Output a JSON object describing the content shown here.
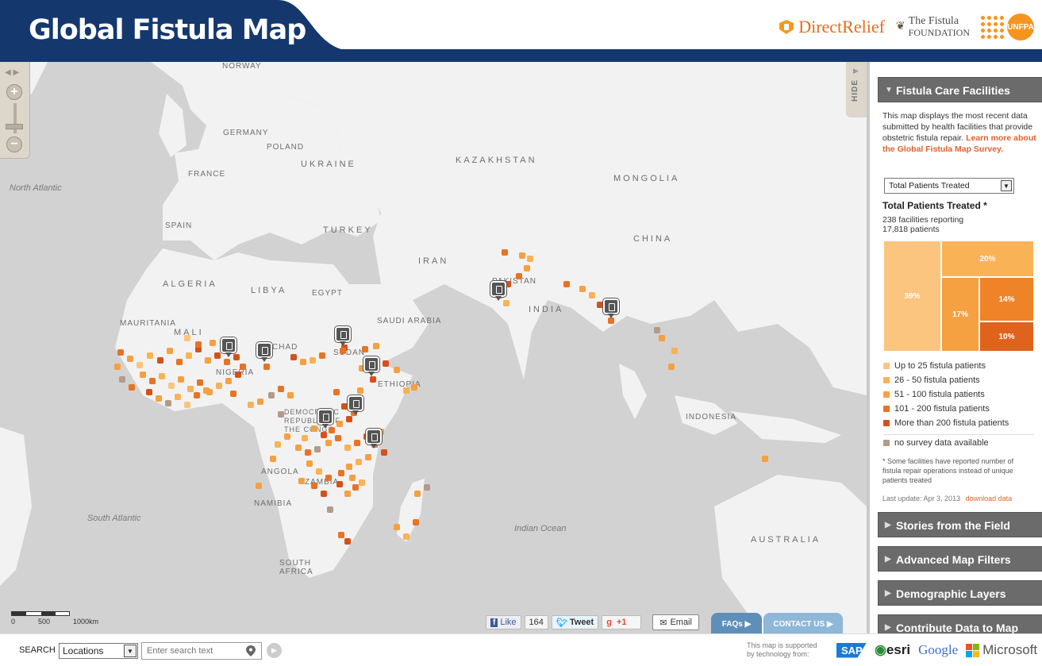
{
  "header": {
    "title": "Global Fistula Map",
    "logos": {
      "direct_relief": "DirectRelief",
      "fistula_line1": "The Fistula",
      "fistula_line2": "Foundation",
      "unfpa": "UNFPA"
    }
  },
  "map": {
    "zoom_in": "+",
    "zoom_out": "−",
    "hide_label": "HIDE",
    "ocean_labels": [
      "North Atlantic",
      "South Atlantic",
      "Indian Ocean"
    ],
    "country_labels": [
      "NORWAY",
      "GERMANY",
      "POLAND",
      "FRANCE",
      "UKRAINE",
      "KAZAKHSTAN",
      "MONGOLIA",
      "SPAIN",
      "TURKEY",
      "CHINA",
      "IRAN",
      "ALGERIA",
      "LIBYA",
      "EGYPT",
      "PAKISTAN",
      "INDIA",
      "SAUDI ARABIA",
      "MAURITANIA",
      "MALI",
      "NIGERIA",
      "CHAD",
      "SUDAN",
      "ETHIOPIA",
      "DEMOCRATIC REPUBLIC OF THE CONGO",
      "ANGOLA",
      "ZAMBIA",
      "NAMIBIA",
      "SOUTH AFRICA",
      "INDONESIA",
      "AUSTRALIA"
    ],
    "scale": {
      "labels": [
        "0",
        "500",
        "1000km"
      ]
    },
    "social": {
      "like": "Like",
      "like_count": "164",
      "tweet": "Tweet",
      "gplus": "+1",
      "email": "Email"
    },
    "faq_tab": "FAQs",
    "contact_tab": "CONTACT US"
  },
  "sidebar": {
    "section_title": "Fistula Care Facilities",
    "description": "This map displays the most recent data submitted by health facilities that provide obstetric fistula repair.",
    "learn_more": "Learn more about the Global Fistula Map Survey.",
    "metric_select": "Total Patients Treated",
    "metric_title": "Total Patients Treated *",
    "facilities_reporting": "238 facilities reporting",
    "patients": "17,818 patients",
    "treemap": [
      {
        "label": "39%",
        "value": 39,
        "color": "#fbc47f"
      },
      {
        "label": "20%",
        "value": 20,
        "color": "#f9b255"
      },
      {
        "label": "17%",
        "value": 17,
        "color": "#f5a041"
      },
      {
        "label": "14%",
        "value": 14,
        "color": "#ef8328"
      },
      {
        "label": "10%",
        "value": 10,
        "color": "#e0631d"
      }
    ],
    "legend": [
      {
        "label": "Up to 25 fistula patients",
        "color": "#fbc47f"
      },
      {
        "label": "26 - 50 fistula patients",
        "color": "#f9b255"
      },
      {
        "label": "51 - 100 fistula patients",
        "color": "#f5a041"
      },
      {
        "label": "101 - 200 fistula patients",
        "color": "#e77324"
      },
      {
        "label": "More than 200 fistula patients",
        "color": "#d4521a"
      }
    ],
    "no_data": {
      "label": "no survey data available",
      "color": "#b39a8c"
    },
    "footnote": "* Some facilities have reported number of fistula repair operations instead of unique patients treated",
    "last_update": "Last update: Apr 3, 2013",
    "download": "download data",
    "collapsed_sections": [
      "Stories from the Field",
      "Advanced Map Filters",
      "Demographic Layers",
      "Contribute Data to Map"
    ]
  },
  "bottombar": {
    "search_label": "SEARCH",
    "search_select": "Locations",
    "search_placeholder": "Enter search text",
    "supported_text": "This map is supported by technology from:",
    "sponsors": [
      "SAP",
      "esri",
      "Google",
      "Microsoft"
    ]
  },
  "colors": {
    "header_blue": "#14386e",
    "accent_orange": "#e2622a",
    "sidebar_header": "#6b6b6b"
  }
}
